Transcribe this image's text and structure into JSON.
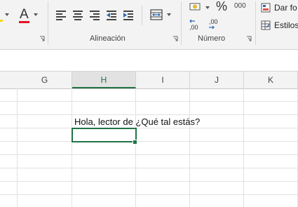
{
  "ribbon": {
    "font_color_glyph": "A",
    "alignment_group_label": "Alineación",
    "number_group_label": "Número",
    "percent_glyph": "%",
    "thousands_glyph": "000",
    "decimal_increase_glyph": ",00",
    "decimal_decrease_glyph": ",00",
    "styles_format_label": "Dar fo",
    "styles_cell_label": "Estilos",
    "font_color_accent": "#e81123"
  },
  "columns": [
    "G",
    "H",
    "I",
    "J",
    "K"
  ],
  "active_column": "H",
  "cell": {
    "text": "Hola, lector de ¿Qué tal estás?"
  },
  "colors": {
    "accent": "#217346"
  }
}
